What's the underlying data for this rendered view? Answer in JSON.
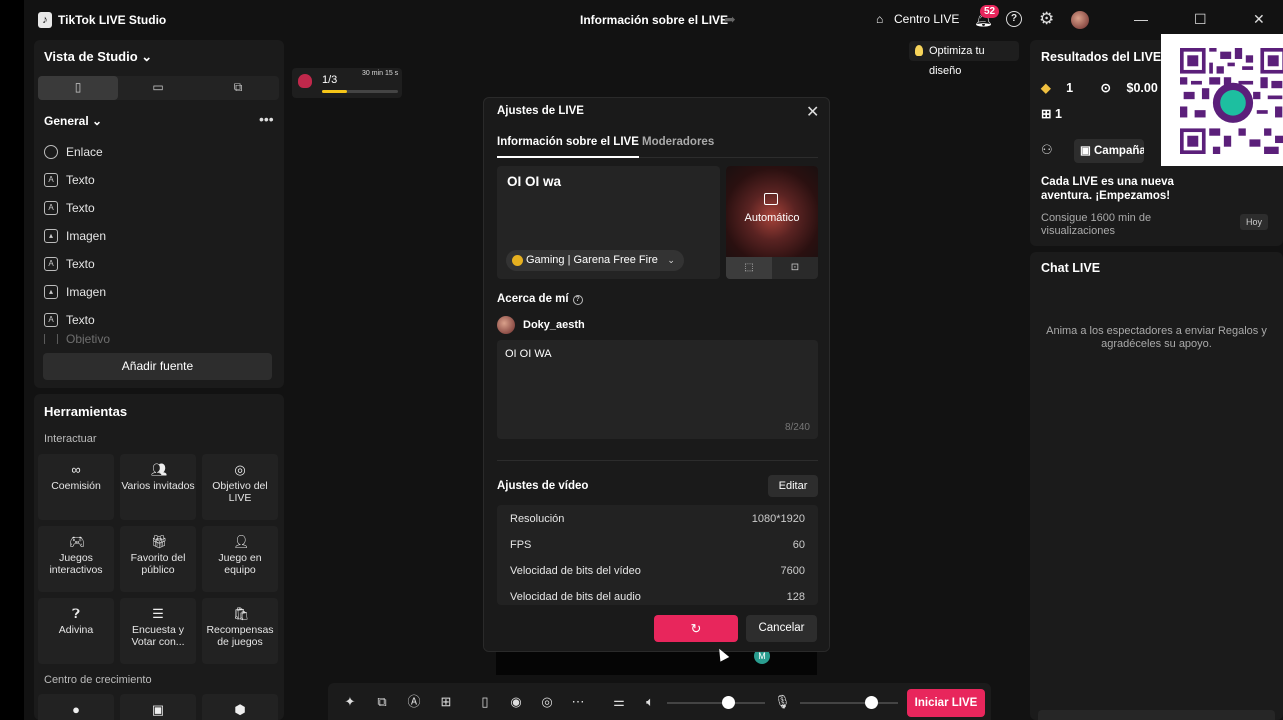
{
  "app": {
    "title": "TikTok LIVE Studio",
    "center_title": "Información sobre el LIVE",
    "centro_live": "Centro LIVE",
    "notifications_count": "52"
  },
  "left": {
    "studio_view": "Vista de Studio",
    "general_label": "General",
    "sources": [
      {
        "label": "Enlace",
        "icon": "globe-icon"
      },
      {
        "label": "Texto",
        "icon": "text-icon"
      },
      {
        "label": "Texto",
        "icon": "text-icon"
      },
      {
        "label": "Imagen",
        "icon": "image-icon"
      },
      {
        "label": "Texto",
        "icon": "text-icon"
      },
      {
        "label": "Imagen",
        "icon": "image-icon"
      },
      {
        "label": "Texto",
        "icon": "text-icon"
      },
      {
        "label": "Objetivo",
        "icon": "goal-icon"
      }
    ],
    "add_source": "Añadir fuente",
    "tools_title": "Herramientas",
    "interact_label": "Interactuar",
    "tools": [
      {
        "label": "Coemisión",
        "icon": "cohost-icon"
      },
      {
        "label": "Varios invitados",
        "icon": "multi-guest-icon"
      },
      {
        "label": "Objetivo del LIVE",
        "icon": "goal-icon"
      },
      {
        "label": "Juegos interactivos",
        "icon": "gamepad-icon"
      },
      {
        "label": "Favorito del público",
        "icon": "gift-icon"
      },
      {
        "label": "Juego en equipo",
        "icon": "team-icon"
      },
      {
        "label": "Adivina",
        "icon": "question-icon"
      },
      {
        "label": "Encuesta y Votar con...",
        "icon": "poll-icon"
      },
      {
        "label": "Recompensas de juegos",
        "icon": "reward-icon"
      }
    ],
    "growth_label": "Centro de crecimiento"
  },
  "preview": {
    "gift_goal_count": "1/3",
    "gift_goal_time": "30 min 15 s",
    "gift_goal_progress": 0.33,
    "optimize_label": "Optimiza tu diseño"
  },
  "modal": {
    "title": "Ajustes de LIVE",
    "tabs": [
      "Información sobre el LIVE",
      "Moderadores"
    ],
    "live_title": "OI OI wa",
    "category": "Gaming | Garena Free Fire",
    "cover_label": "Automático",
    "about_label": "Acerca de mí",
    "username": "Doky_aesth",
    "bio": "OI OI WA",
    "bio_count": "8/240",
    "video_settings_label": "Ajustes de vídeo",
    "edit_label": "Editar",
    "video_settings": [
      {
        "key": "Resolución",
        "value": "1080*1920"
      },
      {
        "key": "FPS",
        "value": "60"
      },
      {
        "key": "Velocidad de bits del vídeo",
        "value": "7600"
      },
      {
        "key": "Velocidad de bits del audio",
        "value": "128"
      }
    ],
    "save_label": "↻",
    "cancel_label": "Cancelar"
  },
  "right": {
    "results_title": "Resultados del LIVE",
    "diamonds": "1",
    "earnings": "$0.00",
    "gifts": "1",
    "campaign_label": "Campañas",
    "adventure_text": "Cada LIVE es una nueva aventura. ¡Empezamos!",
    "consigue_text": "Consigue 1600 min de visualizaciones",
    "today_label": "Hoy",
    "chat_title": "Chat LIVE",
    "chat_empty": "Anima a los espectadores a enviar Regalos y agradéceles su apoyo."
  },
  "toolbar": {
    "start_live": "Iniciar LIVE",
    "volume_level": 0.62,
    "mic_level": 0.72
  },
  "colors": {
    "accent": "#e8265c",
    "background": "#121212",
    "panel": "#1b1b1b"
  }
}
